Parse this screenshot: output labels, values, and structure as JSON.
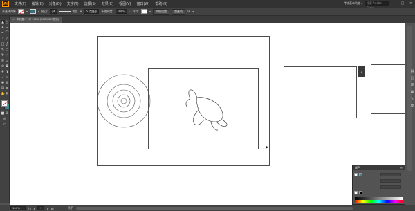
{
  "app": {
    "logo_text": "Ai",
    "menus": [
      "文件(F)",
      "编辑(E)",
      "对象(O)",
      "文字(T)",
      "选择(S)",
      "效果(C)",
      "视图(V)",
      "窗口(W)",
      "帮助(H)"
    ],
    "workspace_label": "传统基本功能",
    "search_placeholder": "搜索 Adobe Stock",
    "window_controls": [
      "–",
      "□",
      "×"
    ]
  },
  "control_bar": {
    "selection_label": "未选择对象",
    "stroke_label": "描边:",
    "stroke_value": "pt",
    "stroke_style_label": "等比",
    "brush_label": "5 点圆形",
    "opacity_label": "不透明度:",
    "opacity_value": "100%",
    "style_label": "样式:",
    "doc_setup_button": "文档设置",
    "preferences_button": "首选项"
  },
  "document_tab": {
    "title": "未标题-1* @ 100% (RGB/GPU 预览)",
    "close": "×"
  },
  "layers_panel": {
    "title": "颜色",
    "menu": "≡"
  },
  "status_bar": {
    "zoom": "100%",
    "page": "1",
    "tool": "抓手",
    "first": "|◂",
    "prev": "◂",
    "next": "▸",
    "last": "▸|"
  },
  "icons": {
    "selection": "selection-arrow-icon",
    "direct_selection": "direct-selection-icon",
    "pen": "pen-icon",
    "type": "type-icon",
    "brush": "paintbrush-icon",
    "hand": "hand-icon",
    "zoom": "zoom-icon"
  }
}
